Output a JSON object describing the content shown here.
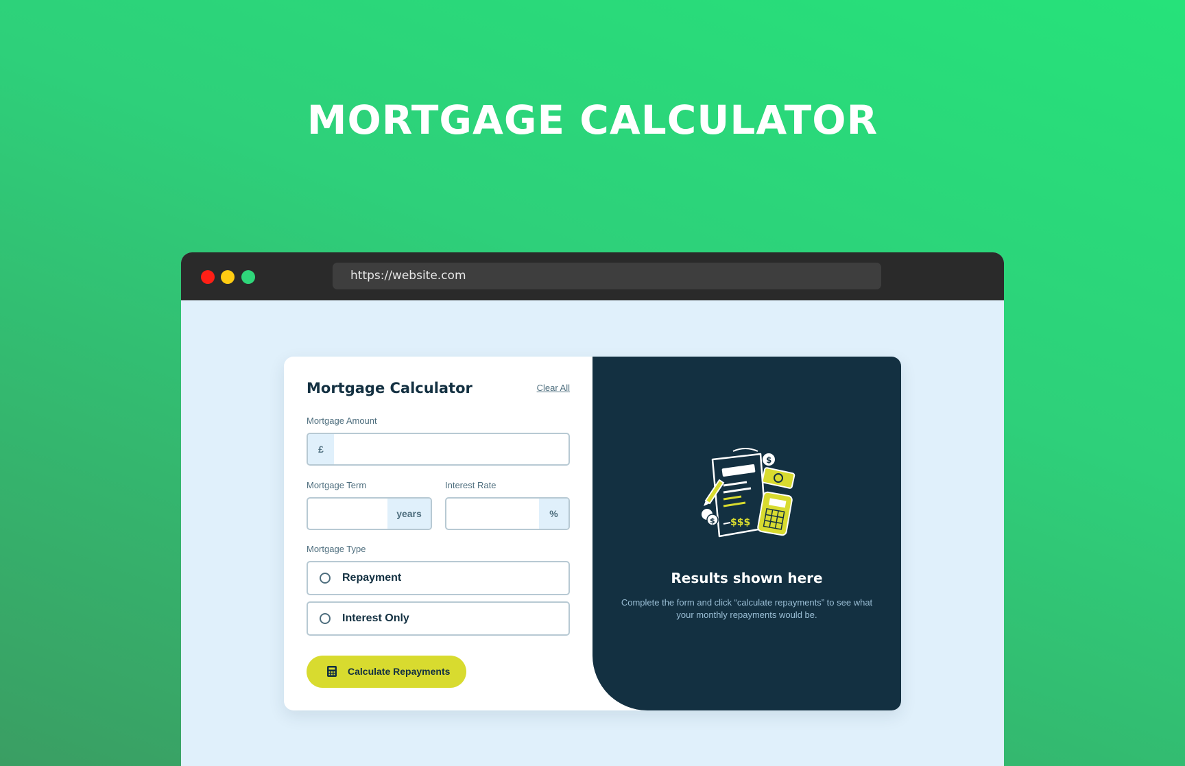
{
  "page": {
    "title": "MORTGAGE CALCULATOR"
  },
  "browser": {
    "url": "https://website.com",
    "controls": [
      "close",
      "minimize",
      "maximize"
    ]
  },
  "form": {
    "title": "Mortgage Calculator",
    "clear_all": "Clear All",
    "amount": {
      "label": "Mortgage Amount",
      "prefix": "£",
      "value": ""
    },
    "term": {
      "label": "Mortgage Term",
      "suffix": "years",
      "value": ""
    },
    "rate": {
      "label": "Interest Rate",
      "suffix": "%",
      "value": ""
    },
    "type": {
      "label": "Mortgage Type",
      "options": [
        {
          "label": "Repayment",
          "selected": false
        },
        {
          "label": "Interest Only",
          "selected": false
        }
      ]
    },
    "submit_label": "Calculate Repayments",
    "submit_icon": "calculator-icon"
  },
  "results": {
    "title": "Results shown here",
    "description": "Complete the form and click “calculate repayments” to see what your monthly repayments would be.",
    "illustration": "empty-results-illustration"
  },
  "colors": {
    "background_start": "#26e27a",
    "background_end": "#3a9e63",
    "browser_bar": "#2a2a2a",
    "viewport": "#e0f0fb",
    "dark": "#133041",
    "lime": "#d8db2f",
    "slate": "#4e6e7e",
    "border": "#b7c9d3"
  }
}
